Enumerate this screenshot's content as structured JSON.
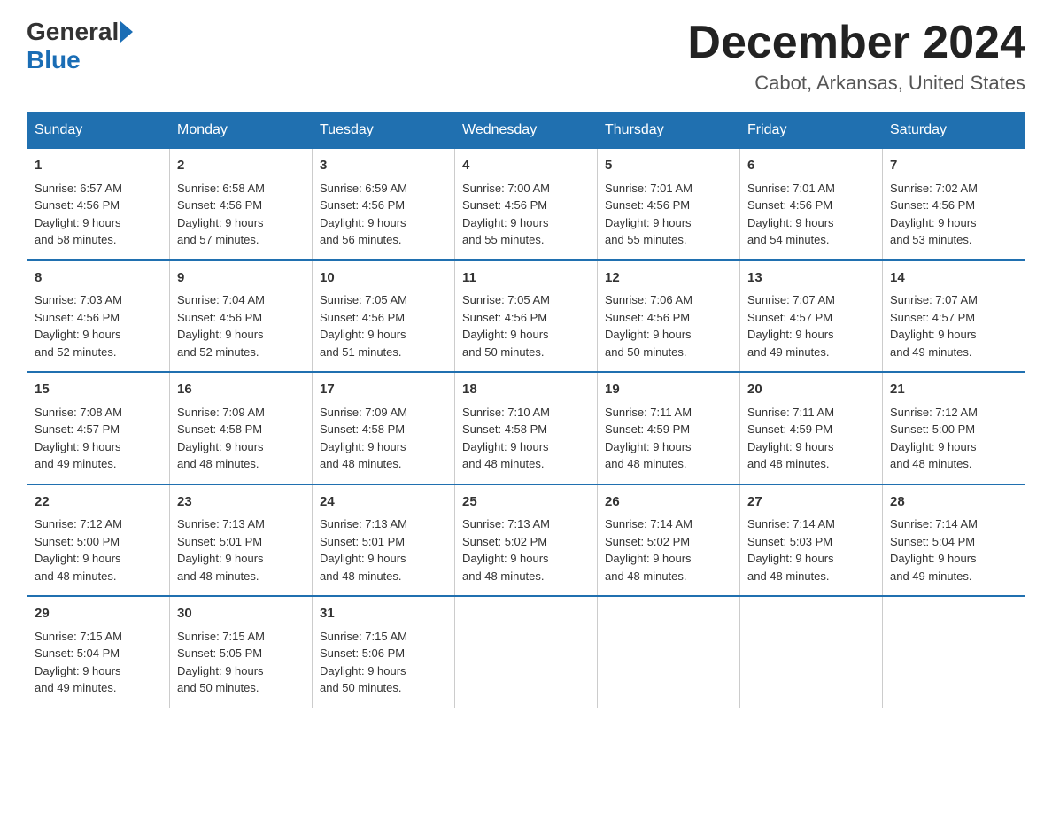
{
  "logo": {
    "general": "General",
    "blue": "Blue"
  },
  "title": "December 2024",
  "location": "Cabot, Arkansas, United States",
  "days_of_week": [
    "Sunday",
    "Monday",
    "Tuesday",
    "Wednesday",
    "Thursday",
    "Friday",
    "Saturday"
  ],
  "weeks": [
    [
      {
        "day": "1",
        "sunrise": "6:57 AM",
        "sunset": "4:56 PM",
        "daylight": "9 hours and 58 minutes."
      },
      {
        "day": "2",
        "sunrise": "6:58 AM",
        "sunset": "4:56 PM",
        "daylight": "9 hours and 57 minutes."
      },
      {
        "day": "3",
        "sunrise": "6:59 AM",
        "sunset": "4:56 PM",
        "daylight": "9 hours and 56 minutes."
      },
      {
        "day": "4",
        "sunrise": "7:00 AM",
        "sunset": "4:56 PM",
        "daylight": "9 hours and 55 minutes."
      },
      {
        "day": "5",
        "sunrise": "7:01 AM",
        "sunset": "4:56 PM",
        "daylight": "9 hours and 55 minutes."
      },
      {
        "day": "6",
        "sunrise": "7:01 AM",
        "sunset": "4:56 PM",
        "daylight": "9 hours and 54 minutes."
      },
      {
        "day": "7",
        "sunrise": "7:02 AM",
        "sunset": "4:56 PM",
        "daylight": "9 hours and 53 minutes."
      }
    ],
    [
      {
        "day": "8",
        "sunrise": "7:03 AM",
        "sunset": "4:56 PM",
        "daylight": "9 hours and 52 minutes."
      },
      {
        "day": "9",
        "sunrise": "7:04 AM",
        "sunset": "4:56 PM",
        "daylight": "9 hours and 52 minutes."
      },
      {
        "day": "10",
        "sunrise": "7:05 AM",
        "sunset": "4:56 PM",
        "daylight": "9 hours and 51 minutes."
      },
      {
        "day": "11",
        "sunrise": "7:05 AM",
        "sunset": "4:56 PM",
        "daylight": "9 hours and 50 minutes."
      },
      {
        "day": "12",
        "sunrise": "7:06 AM",
        "sunset": "4:56 PM",
        "daylight": "9 hours and 50 minutes."
      },
      {
        "day": "13",
        "sunrise": "7:07 AM",
        "sunset": "4:57 PM",
        "daylight": "9 hours and 49 minutes."
      },
      {
        "day": "14",
        "sunrise": "7:07 AM",
        "sunset": "4:57 PM",
        "daylight": "9 hours and 49 minutes."
      }
    ],
    [
      {
        "day": "15",
        "sunrise": "7:08 AM",
        "sunset": "4:57 PM",
        "daylight": "9 hours and 49 minutes."
      },
      {
        "day": "16",
        "sunrise": "7:09 AM",
        "sunset": "4:58 PM",
        "daylight": "9 hours and 48 minutes."
      },
      {
        "day": "17",
        "sunrise": "7:09 AM",
        "sunset": "4:58 PM",
        "daylight": "9 hours and 48 minutes."
      },
      {
        "day": "18",
        "sunrise": "7:10 AM",
        "sunset": "4:58 PM",
        "daylight": "9 hours and 48 minutes."
      },
      {
        "day": "19",
        "sunrise": "7:11 AM",
        "sunset": "4:59 PM",
        "daylight": "9 hours and 48 minutes."
      },
      {
        "day": "20",
        "sunrise": "7:11 AM",
        "sunset": "4:59 PM",
        "daylight": "9 hours and 48 minutes."
      },
      {
        "day": "21",
        "sunrise": "7:12 AM",
        "sunset": "5:00 PM",
        "daylight": "9 hours and 48 minutes."
      }
    ],
    [
      {
        "day": "22",
        "sunrise": "7:12 AM",
        "sunset": "5:00 PM",
        "daylight": "9 hours and 48 minutes."
      },
      {
        "day": "23",
        "sunrise": "7:13 AM",
        "sunset": "5:01 PM",
        "daylight": "9 hours and 48 minutes."
      },
      {
        "day": "24",
        "sunrise": "7:13 AM",
        "sunset": "5:01 PM",
        "daylight": "9 hours and 48 minutes."
      },
      {
        "day": "25",
        "sunrise": "7:13 AM",
        "sunset": "5:02 PM",
        "daylight": "9 hours and 48 minutes."
      },
      {
        "day": "26",
        "sunrise": "7:14 AM",
        "sunset": "5:02 PM",
        "daylight": "9 hours and 48 minutes."
      },
      {
        "day": "27",
        "sunrise": "7:14 AM",
        "sunset": "5:03 PM",
        "daylight": "9 hours and 48 minutes."
      },
      {
        "day": "28",
        "sunrise": "7:14 AM",
        "sunset": "5:04 PM",
        "daylight": "9 hours and 49 minutes."
      }
    ],
    [
      {
        "day": "29",
        "sunrise": "7:15 AM",
        "sunset": "5:04 PM",
        "daylight": "9 hours and 49 minutes."
      },
      {
        "day": "30",
        "sunrise": "7:15 AM",
        "sunset": "5:05 PM",
        "daylight": "9 hours and 50 minutes."
      },
      {
        "day": "31",
        "sunrise": "7:15 AM",
        "sunset": "5:06 PM",
        "daylight": "9 hours and 50 minutes."
      },
      null,
      null,
      null,
      null
    ]
  ],
  "labels": {
    "sunrise": "Sunrise:",
    "sunset": "Sunset:",
    "daylight": "Daylight:"
  }
}
